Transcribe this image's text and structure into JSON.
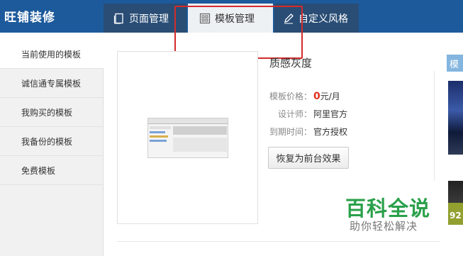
{
  "app": {
    "title": "旺铺装修"
  },
  "tabs": [
    {
      "label": "页面管理",
      "icon": "page-icon"
    },
    {
      "label": "模板管理",
      "icon": "grid-icon",
      "active": true
    },
    {
      "label": "自定义风格",
      "icon": "pen-icon"
    }
  ],
  "sidebar": {
    "items": [
      {
        "label": "当前使用的模板",
        "active": true
      },
      {
        "label": "诚信通专属模板"
      },
      {
        "label": "我购买的模板"
      },
      {
        "label": "我备份的模板"
      },
      {
        "label": "免费模板"
      }
    ]
  },
  "template": {
    "name": "质感灰度",
    "price_label": "模板价格：",
    "price_value": "0",
    "price_unit": "元/月",
    "designer_label": "设计师：",
    "designer_value": "阿里官方",
    "expiry_label": "到期时间：",
    "expiry_value": "官方授权",
    "restore_button": "恢复为前台效果"
  },
  "right_panel": {
    "tag": "模",
    "number": "92"
  },
  "watermark": {
    "main": "百科全说",
    "sub": "助你轻松解决"
  },
  "colors": {
    "header": "#1d5a9b",
    "highlight": "#d42b2b",
    "price": "#e0301e",
    "watermark": "#2aa04a"
  }
}
